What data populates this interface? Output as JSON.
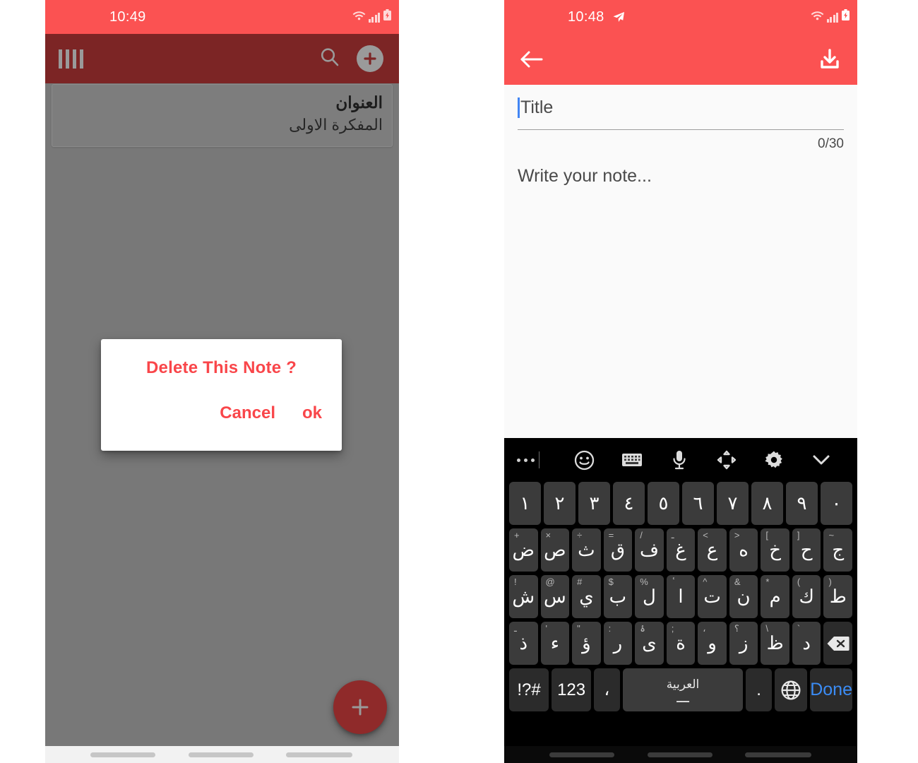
{
  "colors": {
    "status_red": "#fb5252",
    "appbar_dark_red": "#7c2525",
    "dialog_red": "#f9464a",
    "fab_red": "#8f2a2a",
    "done_blue": "#3b8cf5",
    "caret_blue": "#4285f4",
    "keyboard_bg": "#000000",
    "key_bg": "#3b3b3b"
  },
  "left_phone": {
    "status": {
      "time": "10:49",
      "wifi_icon": "wifi-icon",
      "signal_icon": "signal-icon",
      "battery_icon": "battery-charging-icon"
    },
    "appbar": {
      "menu_icon": "menu-bars-icon",
      "search_icon": "search-icon",
      "add_icon": "add-circle-icon"
    },
    "notes": [
      {
        "title": "العنوان",
        "subtitle": "المفكرة الاولى"
      }
    ],
    "dialog": {
      "title": "Delete This Note ?",
      "cancel_label": "Cancel",
      "ok_label": "ok"
    },
    "fab": {
      "icon": "plus-icon"
    },
    "navbar": {
      "pills": 3
    }
  },
  "right_phone": {
    "status": {
      "time": "10:48",
      "send_icon": "telegram-send-icon",
      "wifi_icon": "wifi-icon",
      "signal_icon": "signal-icon",
      "battery_icon": "battery-charging-icon"
    },
    "appbar": {
      "back_icon": "back-arrow-icon",
      "save_icon": "save-download-icon"
    },
    "editor": {
      "title_placeholder": "Title",
      "title_value": "",
      "char_counter": "0/30",
      "note_placeholder": "Write your note...",
      "note_value": ""
    },
    "keyboard": {
      "toolbar": [
        {
          "name": "more-options-icon"
        },
        {
          "name": "emoji-icon"
        },
        {
          "name": "keyboard-icon"
        },
        {
          "name": "microphone-icon"
        },
        {
          "name": "cursor-arrows-icon"
        },
        {
          "name": "gear-icon"
        },
        {
          "name": "chevron-down-icon"
        }
      ],
      "row_digits": [
        {
          "main": "١"
        },
        {
          "main": "٢"
        },
        {
          "main": "٣"
        },
        {
          "main": "٤"
        },
        {
          "main": "٥"
        },
        {
          "main": "٦"
        },
        {
          "main": "٧"
        },
        {
          "main": "٨"
        },
        {
          "main": "٩"
        },
        {
          "main": "٠"
        }
      ],
      "row1": [
        {
          "main": "ض",
          "sup": "+"
        },
        {
          "main": "ص",
          "sup": "×"
        },
        {
          "main": "ث",
          "sup": "÷"
        },
        {
          "main": "ق",
          "sup": "="
        },
        {
          "main": "ف",
          "sup": "/"
        },
        {
          "main": "غ",
          "sup": "ـ"
        },
        {
          "main": "ع",
          "sup": "<"
        },
        {
          "main": "ه",
          "sup": ">"
        },
        {
          "main": "خ",
          "sup": "["
        },
        {
          "main": "ح",
          "sup": "]"
        },
        {
          "main": "ج",
          "sup": "~"
        }
      ],
      "row2": [
        {
          "main": "ش",
          "sup": "!"
        },
        {
          "main": "س",
          "sup": "@"
        },
        {
          "main": "ي",
          "sup": "#"
        },
        {
          "main": "ب",
          "sup": "$"
        },
        {
          "main": "ل",
          "sup": "%"
        },
        {
          "main": "ا",
          "sup": "ٔ"
        },
        {
          "main": "ت",
          "sup": "^"
        },
        {
          "main": "ن",
          "sup": "&"
        },
        {
          "main": "م",
          "sup": "*"
        },
        {
          "main": "ك",
          "sup": "("
        },
        {
          "main": "ط",
          "sup": ")"
        }
      ],
      "row3": [
        {
          "main": "ذ",
          "sup": "ـ"
        },
        {
          "main": "ء",
          "sup": "'"
        },
        {
          "main": "ؤ",
          "sup": "\""
        },
        {
          "main": "ر",
          "sup": ":"
        },
        {
          "main": "ى",
          "sup": "ۀ"
        },
        {
          "main": "ة",
          "sup": ";"
        },
        {
          "main": "و",
          "sup": "،"
        },
        {
          "main": "ز",
          "sup": "؟"
        },
        {
          "main": "ظ",
          "sup": "\\"
        },
        {
          "main": "د",
          "sup": "`"
        }
      ],
      "backspace": {
        "name": "backspace-icon"
      },
      "bottom_row": {
        "symbols_label": "!?#",
        "numbers_label": "123",
        "comma_label": "،",
        "space_label": "العربية",
        "space_underscore": "ـــ",
        "period_label": ".",
        "globe_icon": "globe-icon",
        "done_label": "Done"
      }
    },
    "navbar": {
      "pills": 3
    }
  }
}
